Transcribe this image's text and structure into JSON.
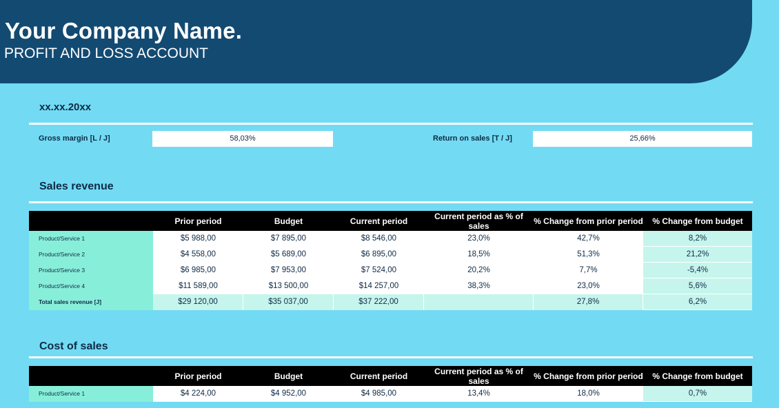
{
  "header": {
    "company": "Your Company Name.",
    "title": "PROFIT AND LOSS ACCOUNT"
  },
  "date": "xx.xx.20xx",
  "kpis": {
    "gross_margin_label": "Gross margin  [L / J]",
    "gross_margin_value": "58,03%",
    "return_on_sales_label": "Return on sales  [T / J]",
    "return_on_sales_value": "25,66%"
  },
  "columns": [
    "",
    "Prior period",
    "Budget",
    "Current period",
    "Current period as % of sales",
    "% Change from prior period",
    "% Change from budget"
  ],
  "sales_revenue": {
    "title": "Sales revenue",
    "rows": [
      [
        "Product/Service 1",
        "$5 988,00",
        "$7 895,00",
        "$8 546,00",
        "23,0%",
        "42,7%",
        "8,2%"
      ],
      [
        "Product/Service 2",
        "$4 558,00",
        "$5 689,00",
        "$6 895,00",
        "18,5%",
        "51,3%",
        "21,2%"
      ],
      [
        "Product/Service 3",
        "$6 985,00",
        "$7 953,00",
        "$7 524,00",
        "20,2%",
        "7,7%",
        "-5,4%"
      ],
      [
        "Product/Service 4",
        "$11 589,00",
        "$13 500,00",
        "$14 257,00",
        "38,3%",
        "23,0%",
        "5,6%"
      ]
    ],
    "total": [
      "Total sales revenue  [J]",
      "$29 120,00",
      "$35 037,00",
      "$37 222,00",
      "",
      "27,8%",
      "6,2%"
    ]
  },
  "cost_of_sales": {
    "title": "Cost of sales",
    "rows": [
      [
        "Product/Service 1",
        "$4 224,00",
        "$4 952,00",
        "$4 985,00",
        "13,4%",
        "18,0%",
        "0,7%"
      ]
    ]
  }
}
